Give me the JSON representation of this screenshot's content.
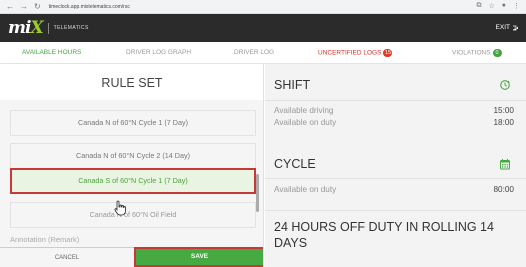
{
  "browser": {
    "url": "timeclock.app.mixtelematics.com/rsc"
  },
  "header": {
    "logo_mark": "mi",
    "logo_x": "X",
    "logo_text": "TELEMATICS",
    "exit_label": "EXIT"
  },
  "tabs": [
    {
      "label": "AVAILABLE HOURS",
      "active": true
    },
    {
      "label": "DRIVER LOG GRAPH",
      "active": false
    },
    {
      "label": "DRIVER LOG",
      "active": false
    },
    {
      "label": "UNCERTIFIED LOGS",
      "badge": "15",
      "active": false
    },
    {
      "label": "VIOLATIONS",
      "badge": "0",
      "active": false
    }
  ],
  "rule_set": {
    "title": "RULE SET",
    "items": [
      {
        "label": "Canada N of 60°N Cycle 1 (7 Day)",
        "selected": false
      },
      {
        "label": "Canada N of 60°N Cycle 2 (14 Day)",
        "selected": false
      },
      {
        "label": "Canada S of 60°N Cycle 1 (7 Day)",
        "selected": true
      },
      {
        "label": "Canada N of 60°N Oil Field",
        "selected": false
      }
    ],
    "annotation_placeholder": "Annotation (Remark)",
    "cancel_label": "CANCEL",
    "save_label": "SAVE"
  },
  "shift": {
    "title": "SHIFT",
    "rows": [
      {
        "label": "Available driving",
        "value": "15:00"
      },
      {
        "label": "Available on duty",
        "value": "18:00"
      }
    ]
  },
  "cycle": {
    "title": "CYCLE",
    "rows": [
      {
        "label": "Available on duty",
        "value": "80:00"
      }
    ]
  },
  "off_duty": {
    "title": "24 HOURS OFF DUTY IN ROLLING 14 DAYS"
  },
  "colors": {
    "accent_green": "#45aa41",
    "alert_red": "#e0392b",
    "header_dark": "#2b2b2b"
  }
}
